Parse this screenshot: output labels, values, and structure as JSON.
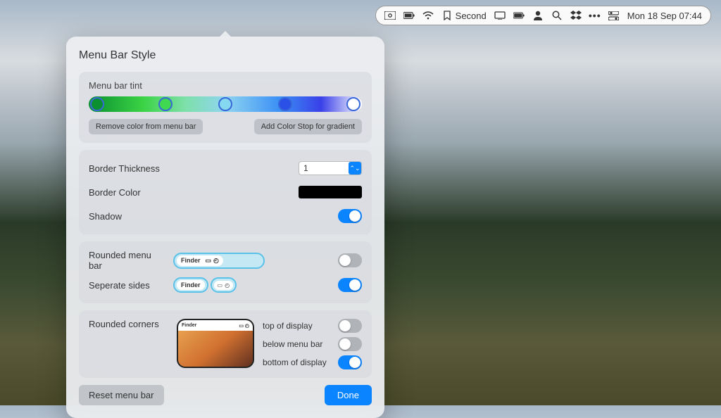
{
  "menubar": {
    "second_label": "Second",
    "datetime": "Mon 18 Sep  07:44",
    "icons": {
      "cam": "camera-icon",
      "battery_menu": "battery-menu-icon",
      "wifi": "wifi-icon",
      "bookmark": "bookmark-icon",
      "display": "display-icon",
      "battery": "battery-icon",
      "user": "user-silhouette-icon",
      "search": "search-icon",
      "dropbox": "dropbox-icon",
      "more": "more-icon",
      "control": "control-center-icon"
    }
  },
  "panel": {
    "title": "Menu Bar Style",
    "tint": {
      "label": "Menu bar tint",
      "remove_label": "Remove color from menu bar",
      "add_stop_label": "Add Color Stop for gradient",
      "stops": [
        {
          "pos": 3,
          "color": "#0a9030"
        },
        {
          "pos": 28,
          "color": "#40d850"
        },
        {
          "pos": 50,
          "color": "#85d8f0"
        },
        {
          "pos": 72,
          "color": "#2a50e8"
        },
        {
          "pos": 97,
          "color": "#ffffff"
        }
      ]
    },
    "border": {
      "thickness_label": "Border Thickness",
      "thickness_value": "1",
      "color_label": "Border Color",
      "color_value": "#000000",
      "shadow_label": "Shadow",
      "shadow_on": true
    },
    "rounded": {
      "rounded_menubar_label": "Rounded menu bar",
      "rounded_menubar_on": false,
      "separate_sides_label": "Seperate sides",
      "separate_sides_on": true,
      "preview_finder": "Finder"
    },
    "corners": {
      "label": "Rounded corners",
      "preview_finder": "Finder",
      "top_label": "top of display",
      "top_on": false,
      "below_label": "below menu bar",
      "below_on": false,
      "bottom_label": "bottom of display",
      "bottom_on": true
    },
    "footer": {
      "reset_label": "Reset menu bar",
      "done_label": "Done"
    }
  }
}
